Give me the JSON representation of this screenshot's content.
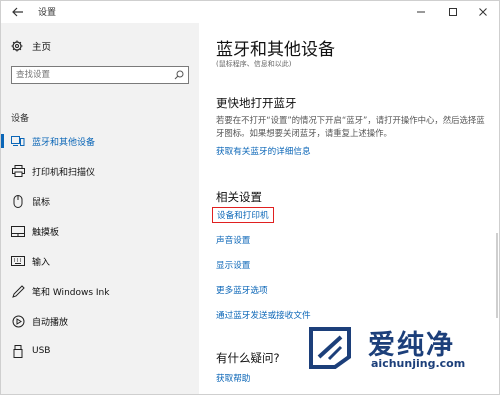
{
  "window": {
    "title": "设置"
  },
  "sidebar": {
    "home_label": "主页",
    "search_placeholder": "查找设置",
    "section_label": "设备",
    "items": [
      {
        "label": "蓝牙和其他设备",
        "icon": "bluetooth-devices-icon",
        "active": true
      },
      {
        "label": "打印机和扫描仪",
        "icon": "printer-icon"
      },
      {
        "label": "鼠标",
        "icon": "mouse-icon"
      },
      {
        "label": "触摸板",
        "icon": "touchpad-icon"
      },
      {
        "label": "输入",
        "icon": "keyboard-icon"
      },
      {
        "label": "笔和 Windows Ink",
        "icon": "pen-icon"
      },
      {
        "label": "自动播放",
        "icon": "autoplay-icon"
      },
      {
        "label": "USB",
        "icon": "usb-icon"
      }
    ]
  },
  "main": {
    "title": "蓝牙和其他设备",
    "subtitle": "(鼠标程序、信息和以此)",
    "quick_heading": "更快地打开蓝牙",
    "quick_text": "若要在不打开“设置”的情况下开启“蓝牙”，请打开操作中心，然后选择蓝牙图标。如果想要关闭蓝牙，请重复上述操作。",
    "quick_link": "获取有关蓝牙的详细信息",
    "related_heading": "相关设置",
    "related_links": [
      "设备和打印机",
      "声音设置",
      "显示设置",
      "更多蓝牙选项",
      "通过蓝牙发送或接收文件"
    ],
    "question_heading": "有什么疑问?",
    "help_link": "获取帮助"
  },
  "watermark": {
    "cn": "爱纯净",
    "en": "aichunjing.com"
  },
  "colors": {
    "accent": "#0b66b7",
    "highlight_box": "#e02020",
    "sidebar_bg": "#f2f2f2"
  }
}
